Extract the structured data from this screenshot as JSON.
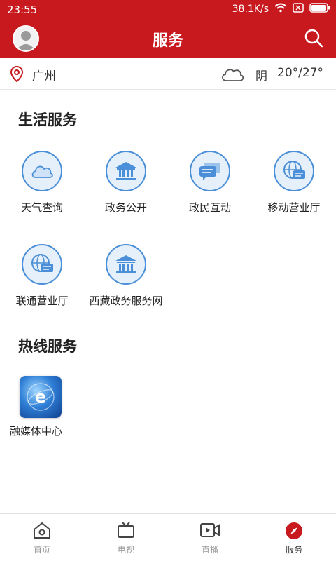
{
  "status_bar": {
    "time": "23:55",
    "net_speed": "38.1K/s"
  },
  "header": {
    "title": "服务"
  },
  "location": {
    "city": "广州",
    "weather": "阴",
    "temperature": "20°/27°"
  },
  "sections": {
    "life": {
      "title": "生活服务",
      "items": [
        {
          "label": "天气查询",
          "icon": "cloud-icon"
        },
        {
          "label": "政务公开",
          "icon": "government-building-icon"
        },
        {
          "label": "政民互动",
          "icon": "chat-bubbles-icon"
        },
        {
          "label": "移动营业厅",
          "icon": "globe-chat-icon"
        },
        {
          "label": "联通营业厅",
          "icon": "globe-chat-icon"
        },
        {
          "label": "西藏政务服务网",
          "icon": "government-building-icon"
        }
      ]
    },
    "hotline": {
      "title": "热线服务",
      "items": [
        {
          "label": "融媒体中心",
          "icon": "globe-app-icon"
        }
      ]
    }
  },
  "tabbar": {
    "items": [
      {
        "label": "首页",
        "icon": "home-icon"
      },
      {
        "label": "电视",
        "icon": "tv-icon"
      },
      {
        "label": "直播",
        "icon": "live-video-icon"
      },
      {
        "label": "服务",
        "icon": "compass-icon",
        "active": true
      }
    ]
  },
  "colors": {
    "brand": "#c8191e",
    "icon_blue": "#4a8fd8",
    "icon_bg": "#e6f0fb"
  }
}
